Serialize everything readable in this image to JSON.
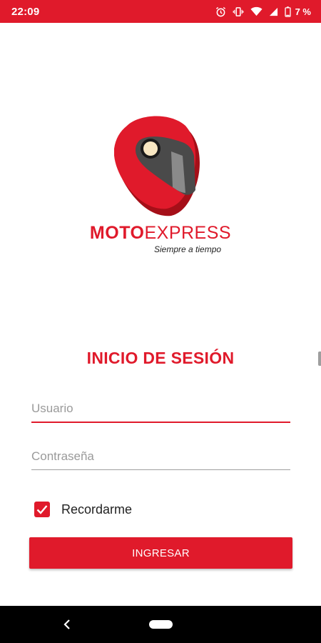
{
  "status_bar": {
    "time": "22:09",
    "battery_percent": "7 %",
    "icons": [
      "alarm-icon",
      "vibrate-icon",
      "wifi-icon",
      "signal-icon",
      "battery-icon"
    ]
  },
  "logo": {
    "brand_bold": "MOTO",
    "brand_light": "EXPRESS",
    "tagline": "Siempre a tiempo"
  },
  "login": {
    "title": "INICIO DE SESIÓN",
    "username_placeholder": "Usuario",
    "password_placeholder": "Contraseña",
    "remember_label": "Recordarme",
    "remember_checked": true,
    "submit_label": "INGRESAR"
  },
  "colors": {
    "brand_red": "#e01a2b",
    "helmet_dark_red": "#a50f18",
    "visor_dark": "#4a4a4a",
    "visor_light": "#8a8a8a",
    "nav_bar": "#000000"
  }
}
